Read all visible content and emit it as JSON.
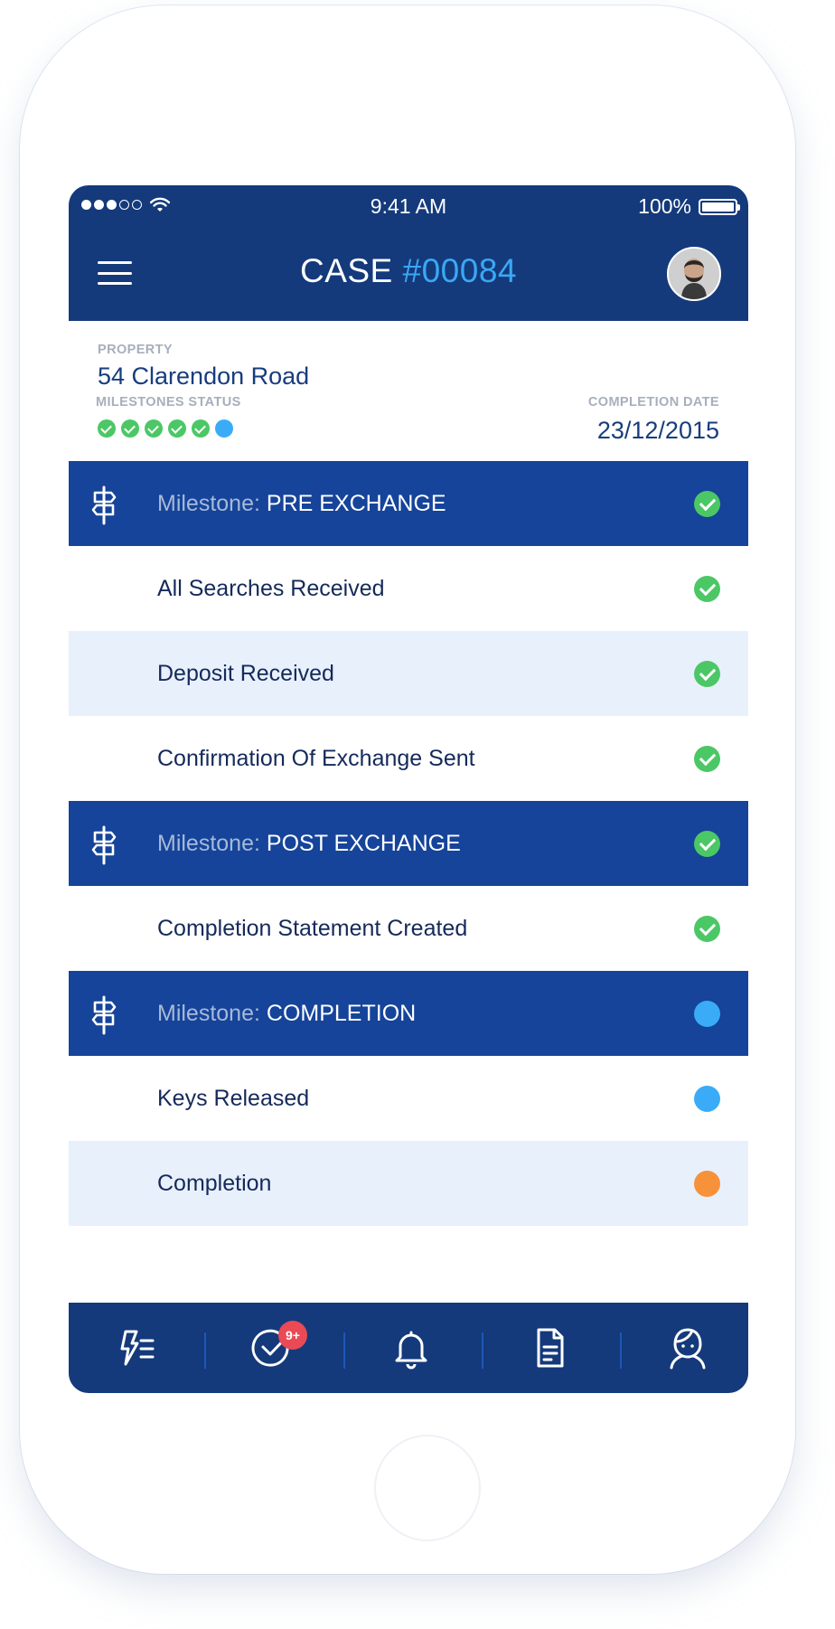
{
  "status_bar": {
    "time": "9:41 AM",
    "battery": "100%"
  },
  "nav": {
    "title_prefix": "CASE",
    "case_number": "#00084"
  },
  "property": {
    "label": "PROPERTY",
    "address": "54 Clarendon Road"
  },
  "milestones_status": {
    "label": "MILESTONES STATUS",
    "completed": 5,
    "pending": 1
  },
  "completion": {
    "label": "COMPLETION DATE",
    "date": "23/12/2015"
  },
  "list": [
    {
      "type": "milestone",
      "prefix": "Milestone:",
      "label": "PRE EXCHANGE",
      "status": "done"
    },
    {
      "type": "task",
      "label": "All Searches Received",
      "status": "done"
    },
    {
      "type": "task",
      "label": "Deposit Received",
      "status": "done"
    },
    {
      "type": "task",
      "label": "Confirmation Of Exchange Sent",
      "status": "done"
    },
    {
      "type": "milestone",
      "prefix": "Milestone:",
      "label": "POST EXCHANGE",
      "status": "done"
    },
    {
      "type": "task",
      "label": "Completion Statement Created",
      "status": "done"
    },
    {
      "type": "milestone",
      "prefix": "Milestone:",
      "label": "COMPLETION",
      "status": "pending"
    },
    {
      "type": "task",
      "label": "Keys Released",
      "status": "pending"
    },
    {
      "type": "task",
      "label": "Completion",
      "status": "late"
    }
  ],
  "tabs": {
    "badge": "9+",
    "icons": [
      "activity-list-icon",
      "tasks-check-icon",
      "bell-icon",
      "document-icon",
      "user-icon"
    ]
  },
  "colors": {
    "nav_bg": "#143a7b",
    "milestone_bg": "#15449a",
    "accent": "#3aa8f5",
    "done": "#4cc766",
    "pending": "#3aacf7",
    "late": "#f7913a",
    "badge": "#ea4a55"
  }
}
